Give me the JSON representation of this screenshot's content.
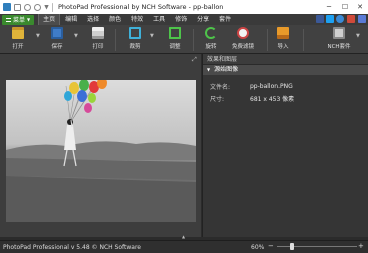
{
  "window": {
    "title": "PhotoPad Professional by NCH Software - pp-ballon"
  },
  "menubar": {
    "main_menu": "菜单",
    "tabs": [
      "主页",
      "编辑",
      "选择",
      "颜色",
      "特效",
      "工具",
      "修饰",
      "分享",
      "套件"
    ]
  },
  "toolbar": {
    "open": "打开",
    "save": "保存",
    "print": "打印",
    "crop": "裁剪",
    "resize": "调整",
    "rotate": "旋转",
    "free_filters": "免费滤镜",
    "import": "导入",
    "nch_suite": "NCH套件"
  },
  "panel": {
    "title": "效果和图层",
    "section": "源始图像",
    "rows": [
      {
        "label": "文件名:",
        "value": "pp-ballon.PNG"
      },
      {
        "label": "尺寸:",
        "value": "681 x 453 像素"
      }
    ]
  },
  "status": {
    "text": "PhotoPad Professional v 5.48 © NCH Software",
    "zoom": "60%",
    "zoom_minus": "−",
    "zoom_plus": "+"
  },
  "colors": {
    "accent_green": "#3a8a2e",
    "balloon_colors": [
      "#e8c438",
      "#49b04a",
      "#e23a3a",
      "#3b6fd6",
      "#ef8a2a",
      "#d64a9a",
      "#2fa6d8",
      "#9ad43a"
    ]
  },
  "icons": [
    "app-icon",
    "save-icon",
    "undo-icon",
    "redo-icon",
    "open-icon",
    "print-icon",
    "crop-icon",
    "resize-icon",
    "rotate-icon",
    "filters-icon",
    "import-icon",
    "nch-suite-icon",
    "expand-icon",
    "collapse-icon",
    "fit-icon",
    "zoom-in-icon",
    "zoom-out-icon"
  ]
}
